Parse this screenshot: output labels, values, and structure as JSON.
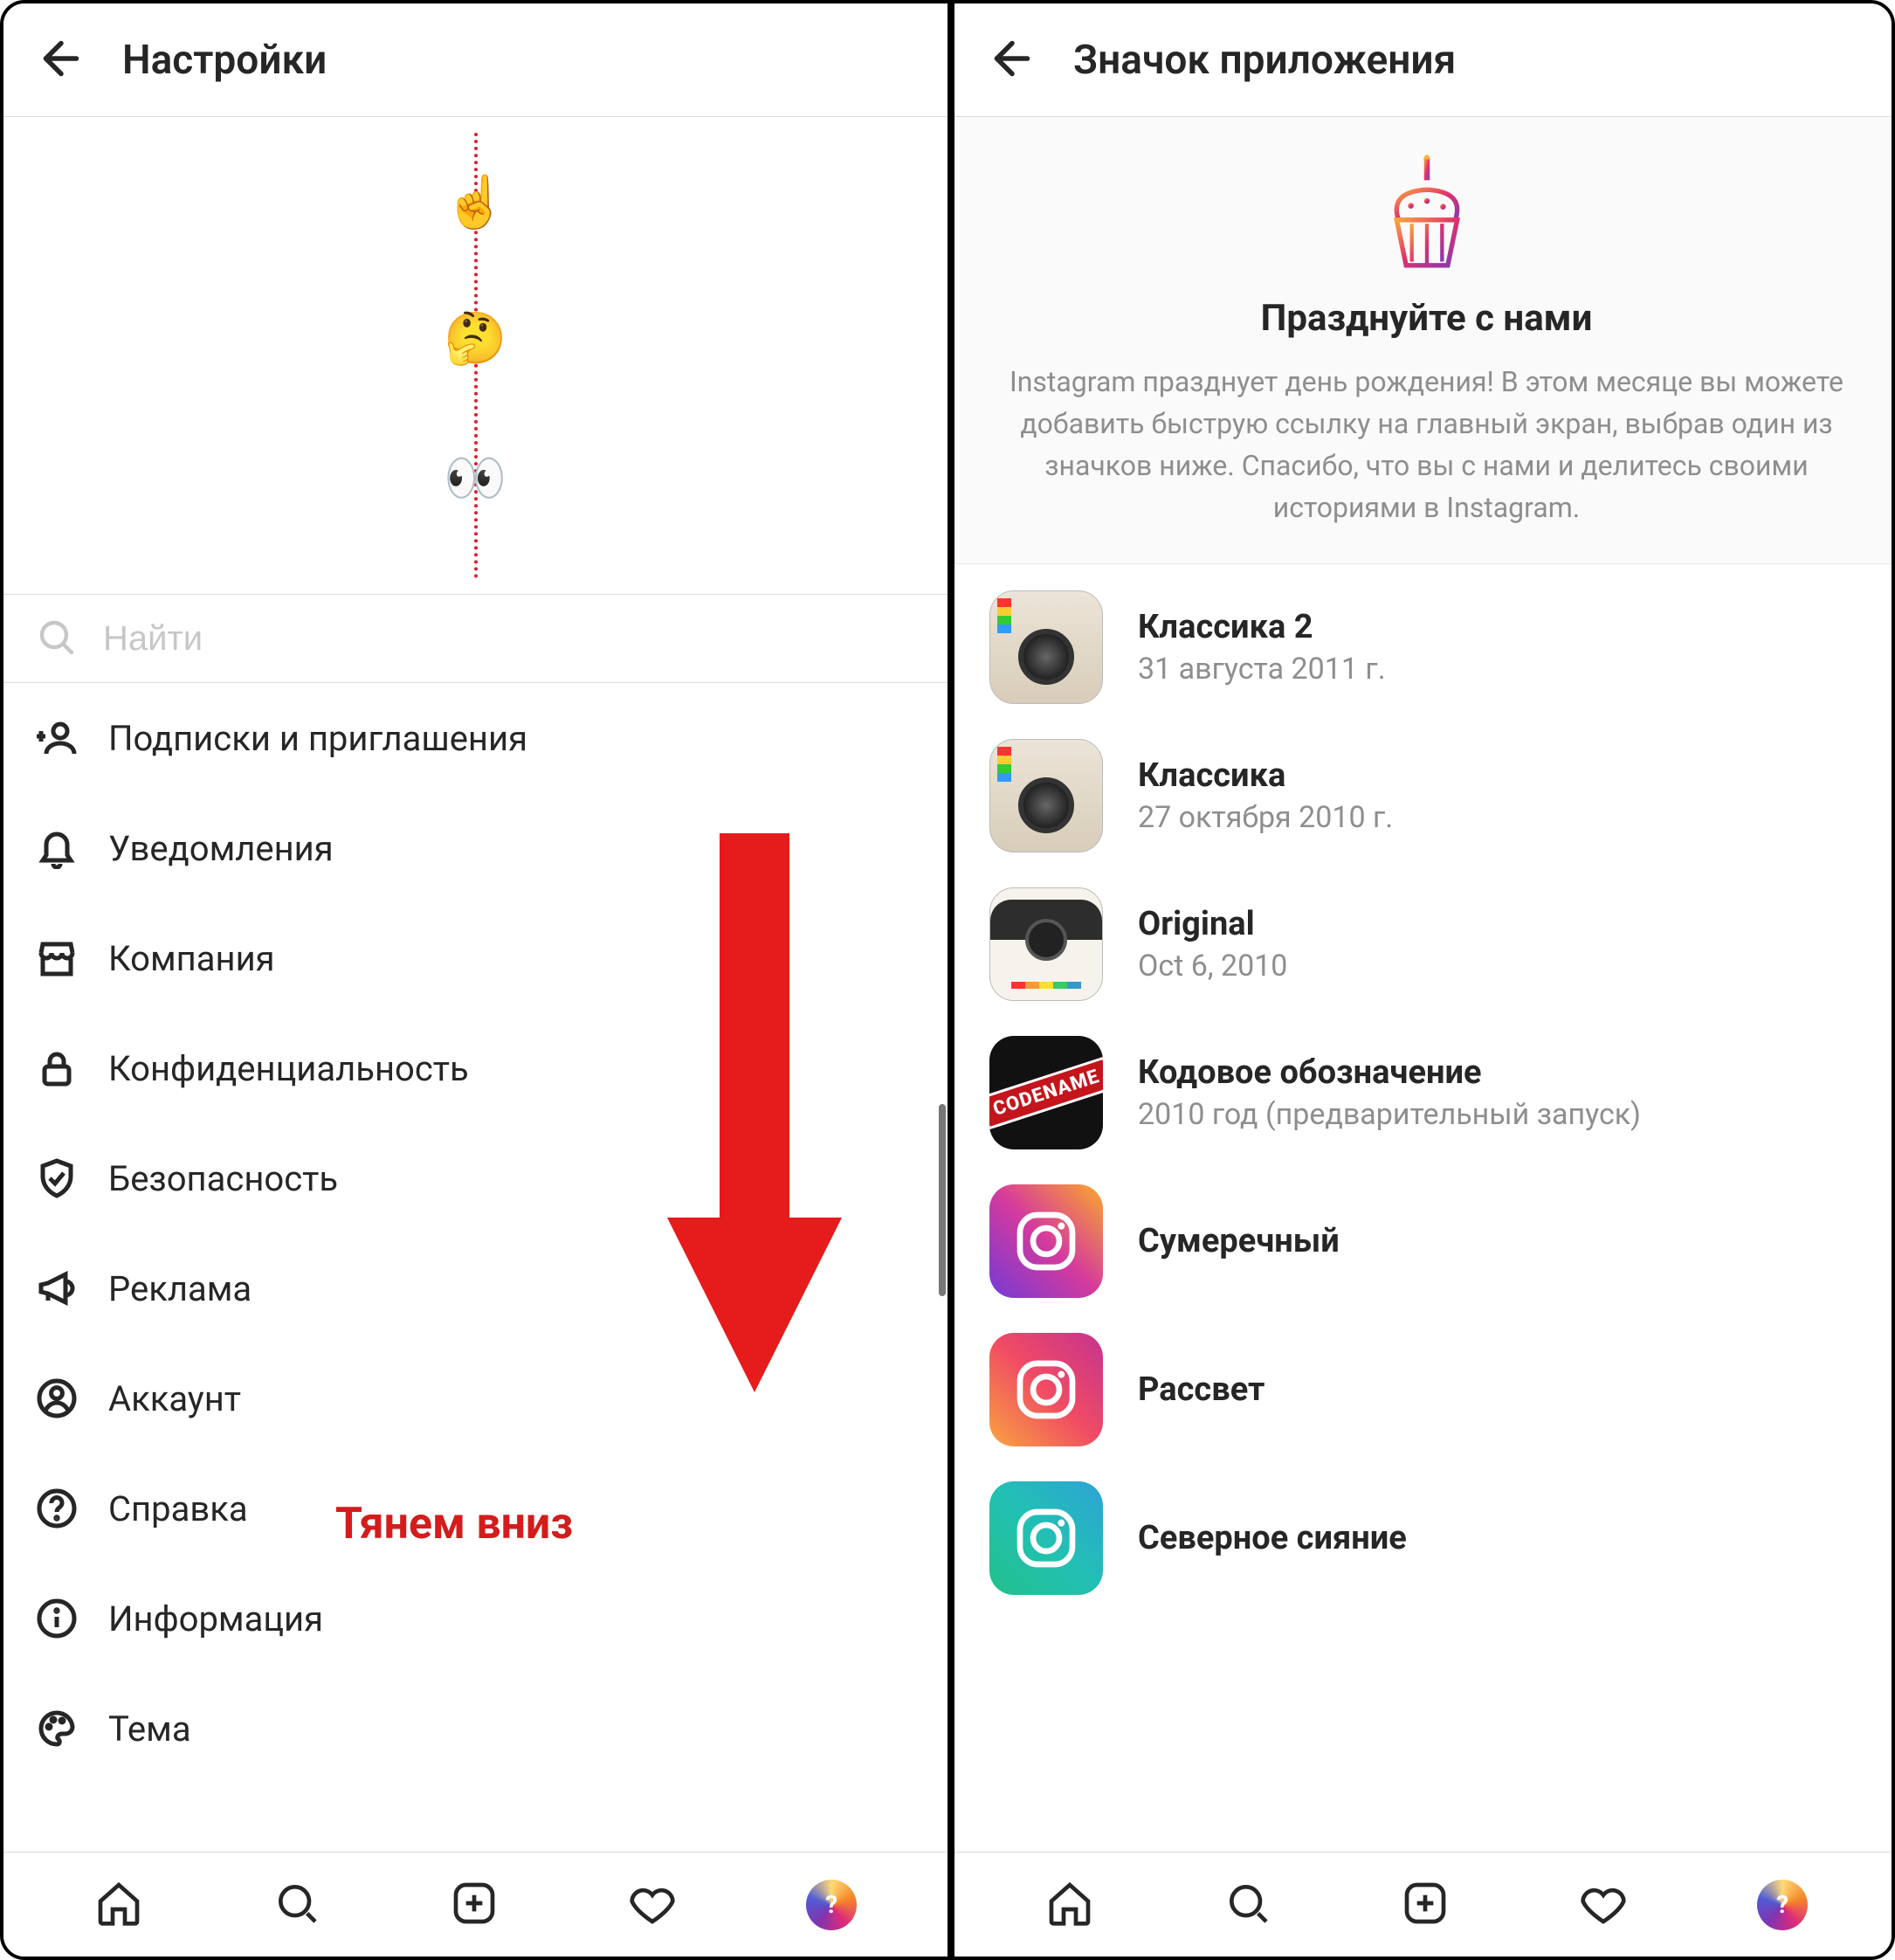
{
  "left": {
    "title": "Настройки",
    "search": {
      "placeholder": "Найти"
    },
    "emojis": [
      "☝️",
      "🤔",
      "👀"
    ],
    "menu": [
      {
        "icon": "follow-invite-icon",
        "label": "Подписки и приглашения"
      },
      {
        "icon": "bell-icon",
        "label": "Уведомления"
      },
      {
        "icon": "store-icon",
        "label": "Компания"
      },
      {
        "icon": "lock-icon",
        "label": "Конфиденциальность"
      },
      {
        "icon": "shield-check-icon",
        "label": "Безопасность"
      },
      {
        "icon": "megaphone-icon",
        "label": "Реклама"
      },
      {
        "icon": "person-circle-icon",
        "label": "Аккаунт"
      },
      {
        "icon": "help-circle-icon",
        "label": "Справка"
      },
      {
        "icon": "info-circle-icon",
        "label": "Информация"
      },
      {
        "icon": "palette-icon",
        "label": "Тема"
      }
    ],
    "annotation": "Тянем вниз"
  },
  "right": {
    "title": "Значок приложения",
    "hero_title": "Празднуйте с нами",
    "hero_body": "Instagram празднует день рождения! В этом месяце вы можете добавить быструю ссылку на главный экран, выбрав один из значков ниже. Спасибо, что вы с нами и делитесь своими историями в Instagram.",
    "icons": [
      {
        "name": "Классика 2",
        "date": "31 августа 2011 г.",
        "thumb": "classic2"
      },
      {
        "name": "Классика",
        "date": "27 октября 2010 г.",
        "thumb": "classic2"
      },
      {
        "name": "Original",
        "date": "Oct 6, 2010",
        "thumb": "original"
      },
      {
        "name": "Кодовое обозначение",
        "date": "2010 год (предварительный запуск)",
        "thumb": "codename"
      },
      {
        "name": "Сумеречный",
        "date": "",
        "thumb": "twilight"
      },
      {
        "name": "Рассвет",
        "date": "",
        "thumb": "sunrise"
      },
      {
        "name": "Северное сияние",
        "date": "",
        "thumb": "aurora"
      }
    ]
  },
  "nav": [
    "home",
    "search",
    "add",
    "activity",
    "profile"
  ]
}
